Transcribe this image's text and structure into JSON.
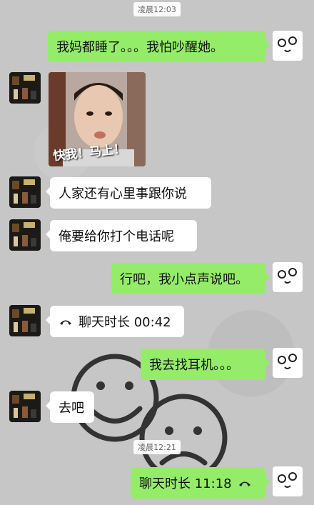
{
  "timestamps": [
    "凌晨12:03",
    "凌晨12:21"
  ],
  "messages": [
    {
      "side": "out",
      "text": "我妈都睡了。。。我怕吵醒她。"
    },
    {
      "side": "in",
      "type": "sticker",
      "caption": "快我！马上！"
    },
    {
      "side": "in",
      "text": "人家还有心里事跟你说"
    },
    {
      "side": "in",
      "text": "俺要给你打个电话呢"
    },
    {
      "side": "out",
      "text": "行吧，我小点声说吧。"
    },
    {
      "side": "in",
      "type": "call",
      "text": "聊天时长 00:42"
    },
    {
      "side": "out",
      "text": "我去找耳机。。。"
    },
    {
      "side": "in",
      "text": "去吧"
    },
    {
      "side": "out",
      "type": "call",
      "text": "聊天时长 11:18"
    }
  ],
  "icons": {
    "call": "phone-hangup-icon",
    "self_avatar": "doodle-face-avatar",
    "peer_avatar": "night-street-photo-avatar"
  },
  "colors": {
    "bubble_out": "#95ec69",
    "bubble_in": "#ffffff",
    "background": "#c6c6c6"
  }
}
